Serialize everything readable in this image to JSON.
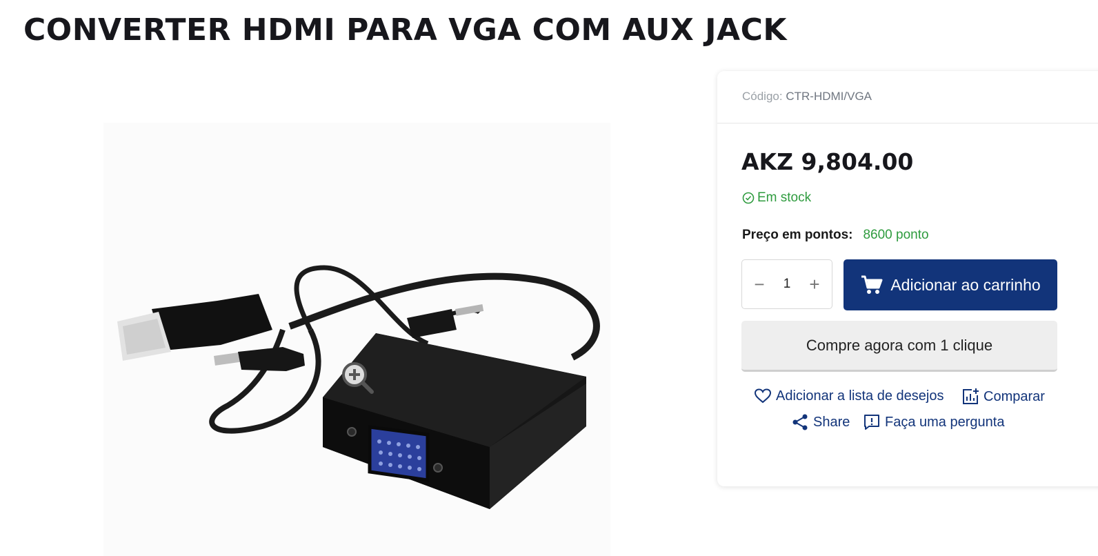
{
  "product": {
    "title": "CONVERTER HDMI PARA VGA COM AUX JACK",
    "image_alt": "HDMI to VGA adapter with audio cable"
  },
  "buy_box": {
    "sku_label": "Código:",
    "sku_value": "CTR-HDMI/VGA",
    "price": "AKZ 9,804.00",
    "stock_status": "Em stock",
    "points_label": "Preço em pontos:",
    "points_value": "8600 ponto",
    "quantity": "1",
    "add_to_cart_label": "Adicionar ao carrinho",
    "buy_now_label": "Compre agora com 1 clique",
    "wishlist_label": "Adicionar a lista de desejos",
    "compare_label": "Comparar",
    "share_label": "Share",
    "question_label": "Faça uma pergunta"
  },
  "colors": {
    "primary": "#12347a",
    "stock_green": "#2e9b3e",
    "title": "#17171c"
  }
}
